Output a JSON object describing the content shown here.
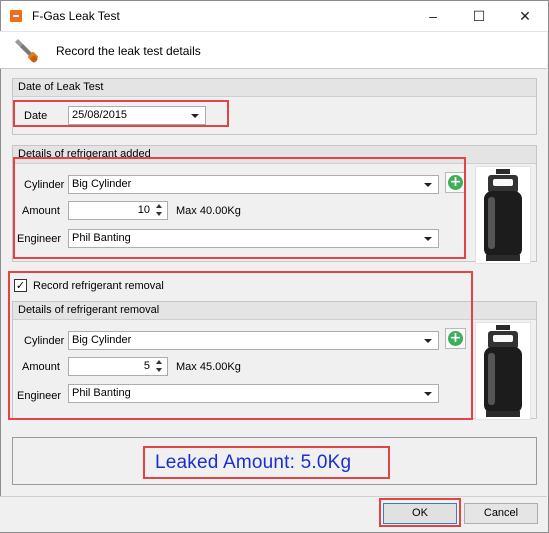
{
  "window": {
    "title": "F-Gas Leak Test",
    "controls": {
      "minimize": "–",
      "maximize": "☐",
      "close": "✕"
    },
    "accent": "#f46a1e"
  },
  "header": {
    "text": "Record the leak test details",
    "icon": "wrench-icon"
  },
  "date_group": {
    "title": "Date of Leak Test",
    "date_label": "Date",
    "date_value": "25/08/2015"
  },
  "added_group": {
    "title": "Details of refrigerant added",
    "cylinder_label": "Cylinder",
    "cylinder_value": "Big Cylinder",
    "amount_label": "Amount",
    "amount_value": "10",
    "max_text": "Max 40.00Kg",
    "engineer_label": "Engineer",
    "engineer_value": "Phil Banting",
    "add_icon": "plus-circle-icon",
    "image_icon": "gas-cylinder-icon"
  },
  "removal": {
    "checkbox_label": "Record refrigerant removal",
    "checked": true,
    "title": "Details of refrigerant removal",
    "cylinder_label": "Cylinder",
    "cylinder_value": "Big Cylinder",
    "amount_label": "Amount",
    "amount_value": "5",
    "max_text": "Max 45.00Kg",
    "engineer_label": "Engineer",
    "engineer_value": "Phil Banting",
    "add_icon": "plus-circle-icon",
    "image_icon": "gas-cylinder-icon"
  },
  "leak": {
    "text": "Leaked Amount: 5.0Kg",
    "color": "#1a2fd0"
  },
  "footer": {
    "ok_label": "OK",
    "cancel_label": "Cancel"
  },
  "highlight_color": "#e04444"
}
